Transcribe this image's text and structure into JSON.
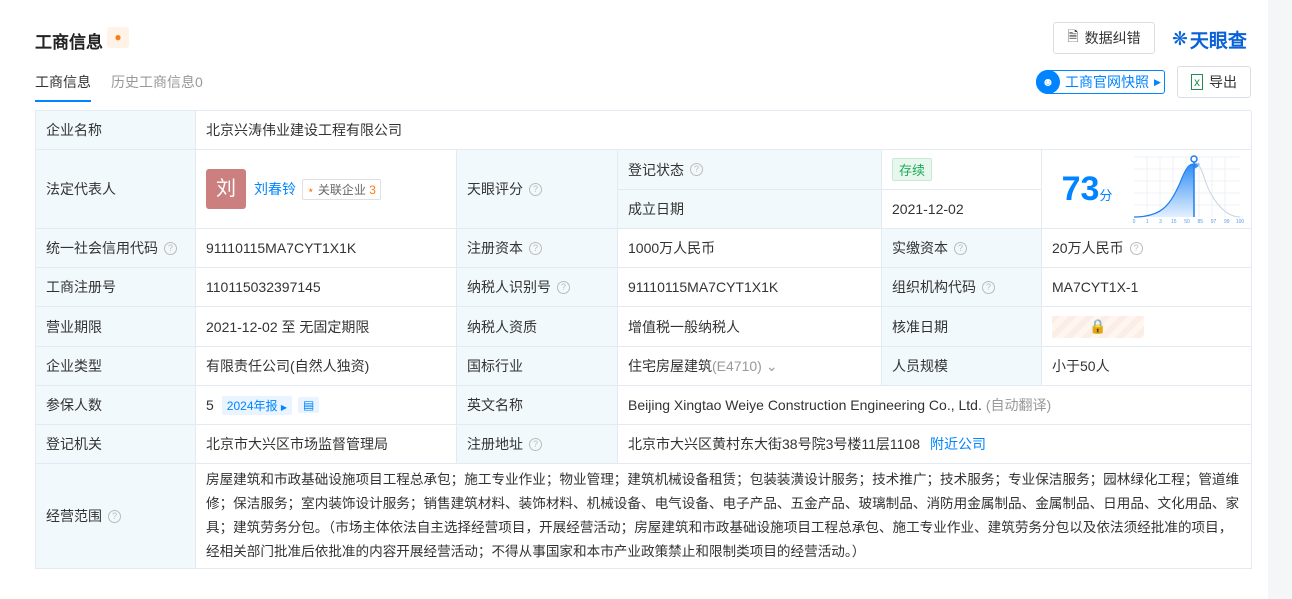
{
  "header": {
    "title": "工商信息",
    "report_error": "数据纠错",
    "brand": "天眼查",
    "snapshot": "工商官网快照",
    "export": "导出"
  },
  "tabs": [
    {
      "label": "工商信息"
    },
    {
      "label": "历史工商信息0"
    }
  ],
  "rows": {
    "company_name": {
      "label": "企业名称",
      "value": "北京兴涛伟业建设工程有限公司"
    },
    "legal_rep": {
      "label": "法定代表人",
      "avatar": "刘",
      "name": "刘春铃",
      "related_label": "关联企业",
      "related_count": "3"
    },
    "reg_status": {
      "label": "登记状态",
      "value": "存续"
    },
    "found_date": {
      "label": "成立日期",
      "value": "2021-12-02"
    },
    "score": {
      "label": "天眼评分",
      "value": "73",
      "unit": "分",
      "ticks": [
        "0",
        "1",
        "3",
        "15",
        "50",
        "85",
        "97",
        "99",
        "100"
      ]
    },
    "credit_code": {
      "label": "统一社会信用代码",
      "value": "91110115MA7CYT1X1K"
    },
    "reg_capital": {
      "label": "注册资本",
      "value": "1000万人民币"
    },
    "paid_capital": {
      "label": "实缴资本",
      "value": "20万人民币"
    },
    "reg_no": {
      "label": "工商注册号",
      "value": "110115032397145"
    },
    "taxpayer_id": {
      "label": "纳税人识别号",
      "value": "91110115MA7CYT1X1K"
    },
    "org_code": {
      "label": "组织机构代码",
      "value": "MA7CYT1X-1"
    },
    "term": {
      "label": "营业期限",
      "value": "2021-12-02 至 无固定期限"
    },
    "taxpayer_qual": {
      "label": "纳税人资质",
      "value": "增值税一般纳税人"
    },
    "approve_date": {
      "label": "核准日期"
    },
    "type": {
      "label": "企业类型",
      "value": "有限责任公司(自然人独资)"
    },
    "industry": {
      "label": "国标行业",
      "value": "住宅房屋建筑",
      "code": "(E4710)"
    },
    "staff": {
      "label": "人员规模",
      "value": "小于50人"
    },
    "insured": {
      "label": "参保人数",
      "value": "5",
      "report": "2024年报"
    },
    "en_name": {
      "label": "英文名称",
      "value": "Beijing Xingtao Weiye Construction Engineering Co., Ltd.",
      "note": "(自动翻译)"
    },
    "authority": {
      "label": "登记机关",
      "value": "北京市大兴区市场监督管理局"
    },
    "address": {
      "label": "注册地址",
      "value": "北京市大兴区黄村东大街38号院3号楼11层1108",
      "nearby": "附近公司"
    },
    "scope": {
      "label": "经营范围",
      "value": "房屋建筑和市政基础设施项目工程总承包；施工专业作业；物业管理；建筑机械设备租赁；包装装潢设计服务；技术推广；技术服务；专业保洁服务；园林绿化工程；管道维修；保洁服务；室内装饰设计服务；销售建筑材料、装饰材料、机械设备、电气设备、电子产品、五金产品、玻璃制品、消防用金属制品、金属制品、日用品、文化用品、家具；建筑劳务分包。（市场主体依法自主选择经营项目，开展经营活动；房屋建筑和市政基础设施项目工程总承包、施工专业作业、建筑劳务分包以及依法须经批准的项目，经相关部门批准后依批准的内容开展经营活动；不得从事国家和本市产业政策禁止和限制类项目的经营活动。）"
    }
  }
}
